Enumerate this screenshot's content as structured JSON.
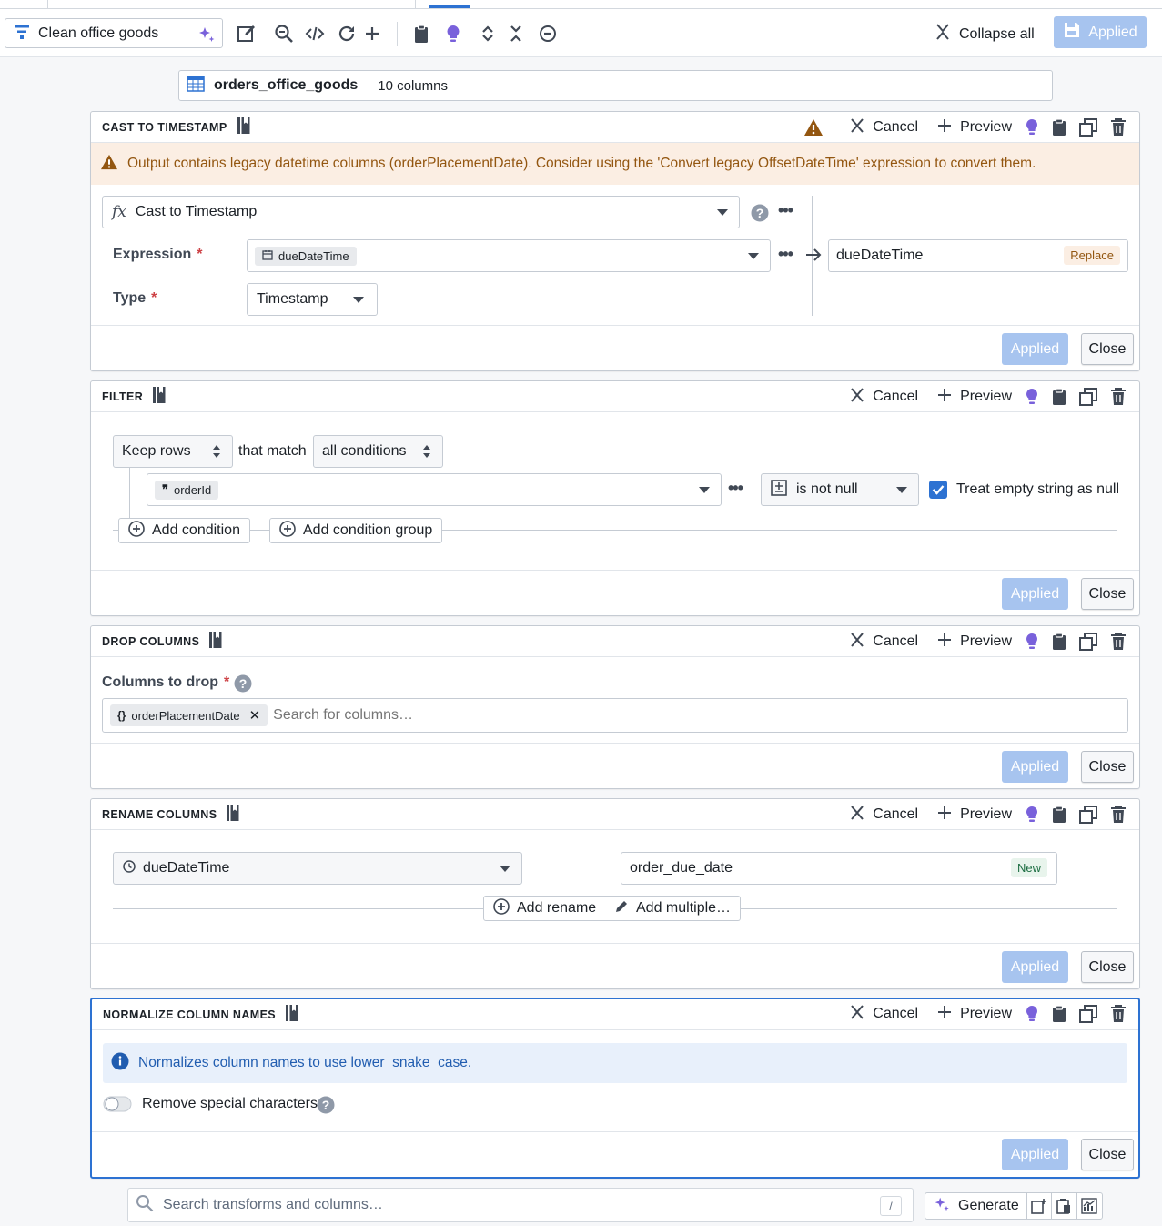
{
  "toolbar": {
    "pipeline_name": "Clean office goods",
    "collapse_all_label": "Collapse all",
    "applied_label": "Applied"
  },
  "dataset": {
    "name": "orders_office_goods",
    "columns": "10 columns"
  },
  "common": {
    "cancel": "Cancel",
    "preview": "Preview",
    "applied": "Applied",
    "close": "Close"
  },
  "cast": {
    "title": "CAST TO TIMESTAMP",
    "warning": "Output contains legacy datetime columns (orderPlacementDate). Consider using the 'Convert legacy OffsetDateTime' expression to convert them.",
    "function": "Cast to Timestamp",
    "expression_label": "Expression",
    "expression_value": "dueDateTime",
    "type_label": "Type",
    "type_value": "Timestamp",
    "output_name": "dueDateTime",
    "output_tag": "Replace"
  },
  "filter": {
    "title": "FILTER",
    "keep_rows": "Keep rows",
    "that_match": "that match",
    "match_mode": "all conditions",
    "column": "orderId",
    "operator": "is not null",
    "treat_empty_label": "Treat empty string as null",
    "treat_empty_checked": true,
    "add_condition": "Add condition",
    "add_condition_group": "Add condition group"
  },
  "drop": {
    "title": "DROP COLUMNS",
    "label": "Columns to drop",
    "selected": "orderPlacementDate",
    "placeholder": "Search for columns…"
  },
  "rename": {
    "title": "RENAME COLUMNS",
    "from": "dueDateTime",
    "to": "order_due_date",
    "to_tag": "New",
    "add_rename": "Add rename",
    "add_multiple": "Add multiple…"
  },
  "normalize": {
    "title": "NORMALIZE COLUMN NAMES",
    "info": "Normalizes column names to use lower_snake_case.",
    "toggle_label": "Remove special characters",
    "toggle_on": false
  },
  "bottom": {
    "search_placeholder": "Search transforms and columns…",
    "shortcut": "/",
    "generate": "Generate"
  },
  "colors": {
    "primary": "#2d72d2",
    "applied_disabled": "#a7c4ef",
    "warning_bg": "#fbeee3",
    "warning_text": "#935610",
    "ai_purple": "#7961db",
    "info_bg": "#e8f0fb"
  }
}
